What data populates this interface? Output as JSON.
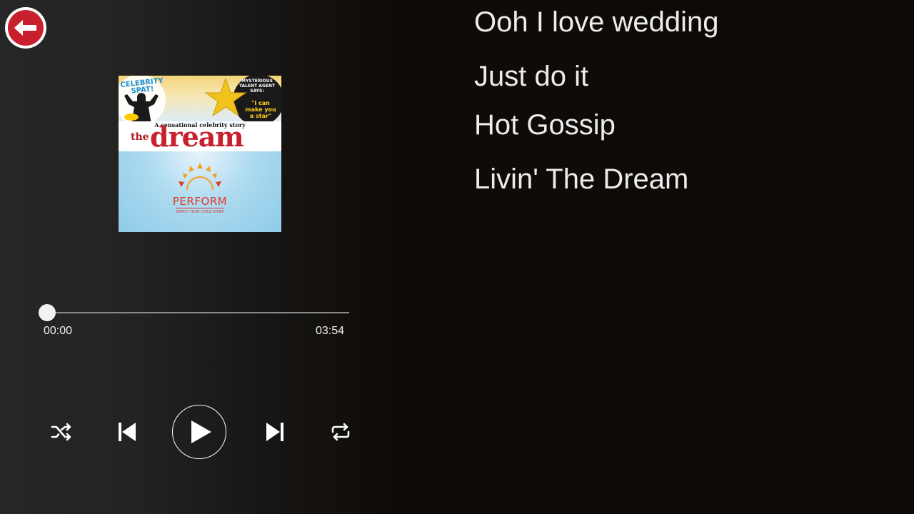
{
  "player": {
    "current_time": "00:00",
    "duration": "03:54",
    "progress": 0
  },
  "album_art": {
    "celebrity_line1": "CELEBRITY",
    "celebrity_line2": "SPAT!",
    "agent_line1": "MYSTERIOUS",
    "agent_line2": "TALENT AGENT",
    "agent_line3": "SAYS:",
    "quote": "\"I can make you a star\"",
    "tagline": "A sensational celebrity story",
    "title_small": "the",
    "title_big": "dream",
    "brand": "PERFORM",
    "brand_tagline": "WATCH YOUR CHILD SHINE"
  },
  "lyrics": [
    "Ooh I love wedding",
    "Just do it",
    "Hot Gossip",
    "Livin' The Dream"
  ],
  "icons": {
    "back": "arrow-left-icon",
    "shuffle": "shuffle-icon",
    "previous": "skip-previous-icon",
    "play": "play-icon",
    "next": "skip-next-icon",
    "repeat": "repeat-icon"
  },
  "colors": {
    "back_button": "#c8202e",
    "progress_track": "#8a8a8a",
    "text": "#ececec"
  }
}
